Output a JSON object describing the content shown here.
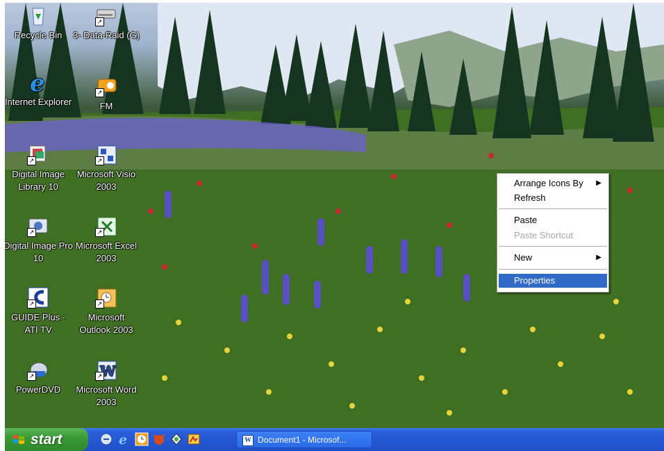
{
  "desktop": {
    "icons": [
      {
        "label": "Recycle Bin",
        "icon": "recycle-bin-icon"
      },
      {
        "label": "3- Data-Raid (G)",
        "icon": "drive-icon"
      },
      {
        "label": "Internet Explorer",
        "icon": "internet-explorer-icon"
      },
      {
        "label": "FM",
        "icon": "fm-radio-icon"
      },
      {
        "label": "Digital Image Library 10",
        "icon": "digital-image-library-icon"
      },
      {
        "label": "Microsoft Visio 2003",
        "icon": "visio-icon"
      },
      {
        "label": "Digital Image Pro 10",
        "icon": "digital-image-pro-icon"
      },
      {
        "label": "Microsoft Excel 2003",
        "icon": "excel-icon"
      },
      {
        "label": "GUIDE Plus - ATI TV",
        "icon": "guide-plus-icon"
      },
      {
        "label": "Microsoft Outlook 2003",
        "icon": "outlook-icon"
      },
      {
        "label": "PowerDVD",
        "icon": "powerdvd-icon"
      },
      {
        "label": "Microsoft Word 2003",
        "icon": "word-icon"
      }
    ]
  },
  "context_menu": {
    "items": [
      {
        "label": "Arrange Icons By",
        "submenu": true,
        "enabled": true
      },
      {
        "label": "Refresh",
        "enabled": true
      },
      {
        "label": "Paste",
        "enabled": true
      },
      {
        "label": "Paste Shortcut",
        "enabled": false
      },
      {
        "label": "New",
        "submenu": true,
        "enabled": true
      },
      {
        "label": "Properties",
        "enabled": true,
        "selected": true
      }
    ],
    "highlight_color": "#316ac5"
  },
  "taskbar": {
    "start_label": "start",
    "quick_launch": [
      "show-desktop-icon",
      "internet-explorer-icon",
      "clock-icon",
      "firefox-icon",
      "messenger-icon",
      "media-icon"
    ],
    "task_button": "Document1 - Microsof...",
    "colors": {
      "taskbar": "#2457d3",
      "start": "#3b9a36"
    }
  }
}
